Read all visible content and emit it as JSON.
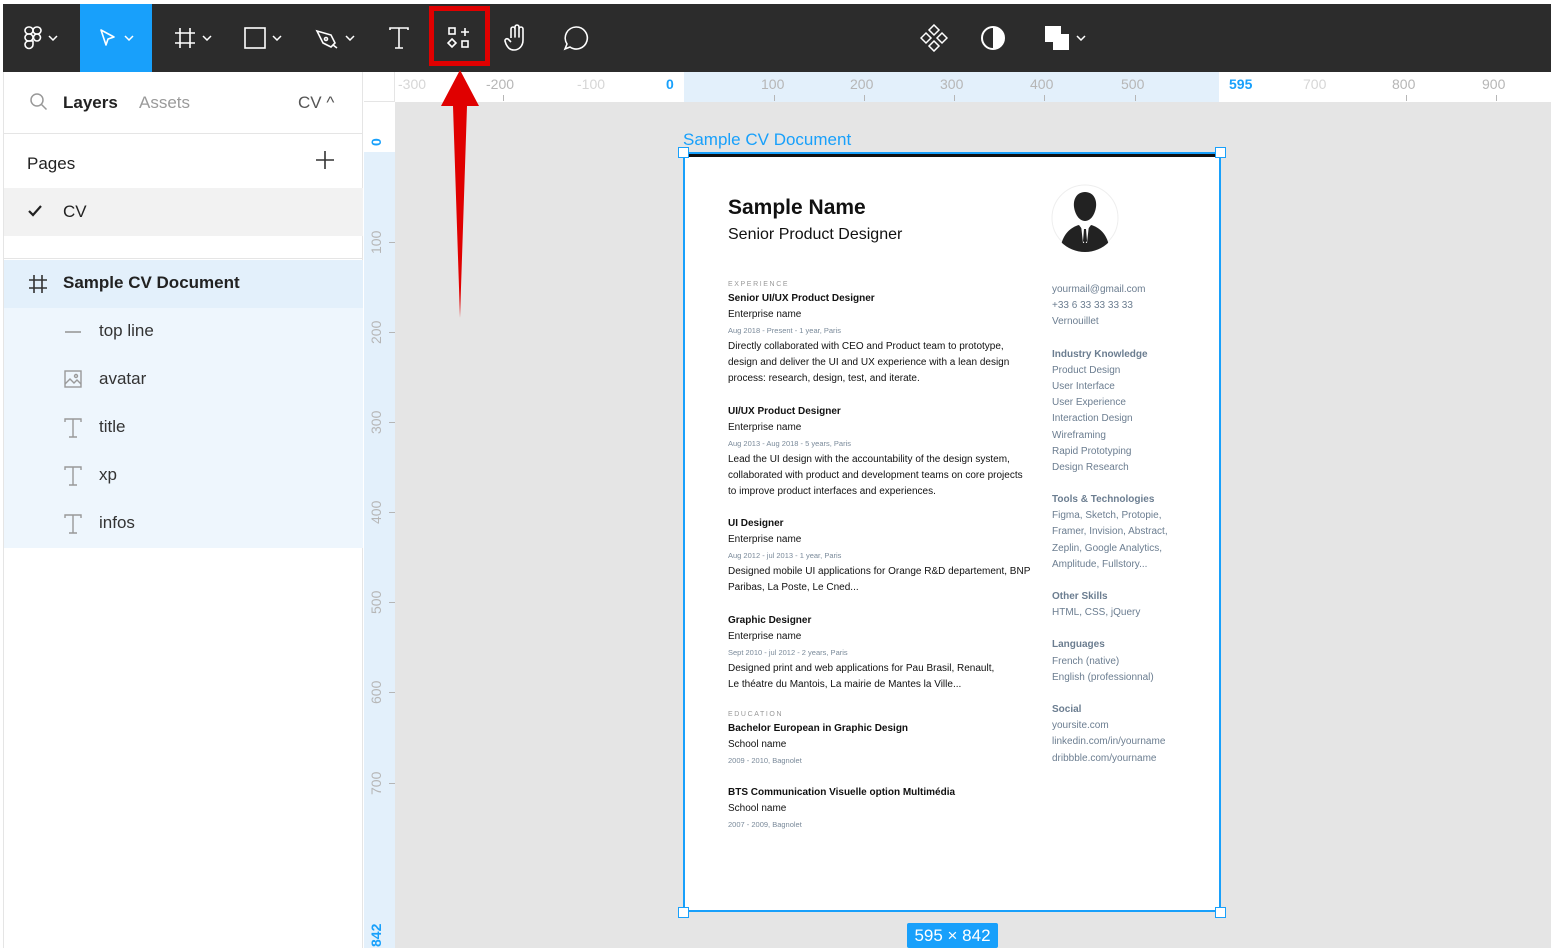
{
  "toolbar": {
    "tools": [
      {
        "name": "main-menu"
      },
      {
        "name": "move-tool",
        "active": true
      },
      {
        "name": "frame-tool"
      },
      {
        "name": "shape-tool"
      },
      {
        "name": "pen-tool"
      },
      {
        "name": "text-tool"
      },
      {
        "name": "resources-tool",
        "highlighted": true
      },
      {
        "name": "hand-tool"
      },
      {
        "name": "comment-tool"
      },
      {
        "name": "components-icon"
      },
      {
        "name": "contrast-icon"
      },
      {
        "name": "boolean-icon"
      }
    ]
  },
  "sidebar": {
    "tabs": {
      "layers": "Layers",
      "assets": "Assets",
      "page_selector": "CV ^"
    },
    "pages_heading": "Pages",
    "pages": [
      {
        "label": "CV",
        "selected": true
      }
    ],
    "frame": {
      "label": "Sample CV Document"
    },
    "layers": [
      {
        "label": "top line",
        "icon": "line-icon"
      },
      {
        "label": "avatar",
        "icon": "image-icon"
      },
      {
        "label": "title",
        "icon": "text-icon"
      },
      {
        "label": "xp",
        "icon": "text-icon"
      },
      {
        "label": "infos",
        "icon": "text-icon"
      }
    ]
  },
  "canvas": {
    "ruler_top": [
      "-300",
      "-200",
      "-100",
      "0",
      "100",
      "200",
      "300",
      "400",
      "500",
      "595",
      "700",
      "800",
      "900"
    ],
    "ruler_left": [
      "0",
      "100",
      "200",
      "300",
      "400",
      "500",
      "600",
      "700",
      "842"
    ],
    "frame_title": "Sample CV Document",
    "size_badge": "595 × 842"
  },
  "cv": {
    "name": "Sample Name",
    "role": "Senior Product Designer",
    "experience_heading": "EXPERIENCE",
    "jobs": [
      {
        "title": "Senior UI/UX Product Designer",
        "enterprise": "Enterprise name",
        "date": "Aug 2018 - Present - 1 year, Paris",
        "desc": [
          "Directly collaborated with CEO and Product team to prototype,",
          "design and deliver the UI and UX experience with a lean design",
          "process: research, design, test, and iterate."
        ]
      },
      {
        "title": "UI/UX Product Designer",
        "enterprise": "Enterprise name",
        "date": "Aug 2013 - Aug 2018 - 5 years, Paris",
        "desc": [
          "Lead the UI design with the accountability of the design system,",
          "collaborated with product and development teams on core projects",
          "to improve product interfaces and experiences."
        ]
      },
      {
        "title": "UI Designer",
        "enterprise": "Enterprise name",
        "date": "Aug 2012 - jul 2013 - 1 year, Paris",
        "desc": [
          "Designed mobile UI applications for Orange R&D departement, BNP",
          "Paribas, La Poste, Le Cned..."
        ]
      },
      {
        "title": "Graphic Designer",
        "enterprise": "Enterprise name",
        "date": "Sept 2010 - jul 2012 - 2 years, Paris",
        "desc": [
          "Designed print and web applications for Pau Brasil, Renault,",
          "Le théatre du Mantois, La mairie de Mantes la Ville..."
        ]
      }
    ],
    "education_heading": "EDUCATION",
    "education": [
      {
        "title": "Bachelor European in Graphic Design",
        "school": "School name",
        "date": "2009 - 2010, Bagnolet"
      },
      {
        "title": "BTS Communication Visuelle option Multimédia",
        "school": "School name",
        "date": "2007 - 2009, Bagnolet"
      }
    ],
    "contact": [
      "yourmail@gmail.com",
      "+33 6 33 33 33 33",
      "Vernouillet"
    ],
    "skills": [
      {
        "heading": "Industry Knowledge",
        "items": [
          "Product Design",
          "User Interface",
          "User Experience",
          "Interaction Design",
          "Wireframing",
          "Rapid Prototyping",
          "Design Research"
        ]
      },
      {
        "heading": "Tools & Technologies",
        "items": [
          "Figma, Sketch, Protopie,",
          "Framer, Invision, Abstract,",
          "Zeplin, Google Analytics,",
          "Amplitude, Fullstory..."
        ]
      },
      {
        "heading": "Other Skills",
        "items": [
          "HTML, CSS, jQuery"
        ]
      },
      {
        "heading": "Languages",
        "items": [
          "French (native)",
          "English (professionnal)"
        ]
      },
      {
        "heading": "Social",
        "items": [
          "yoursite.com",
          "linkedin.com/in/yourname",
          "dribbble.com/yourname"
        ]
      }
    ]
  },
  "colors": {
    "accent": "#18a0fb",
    "toolbar": "#2c2c2c",
    "annotation": "#e00000"
  }
}
